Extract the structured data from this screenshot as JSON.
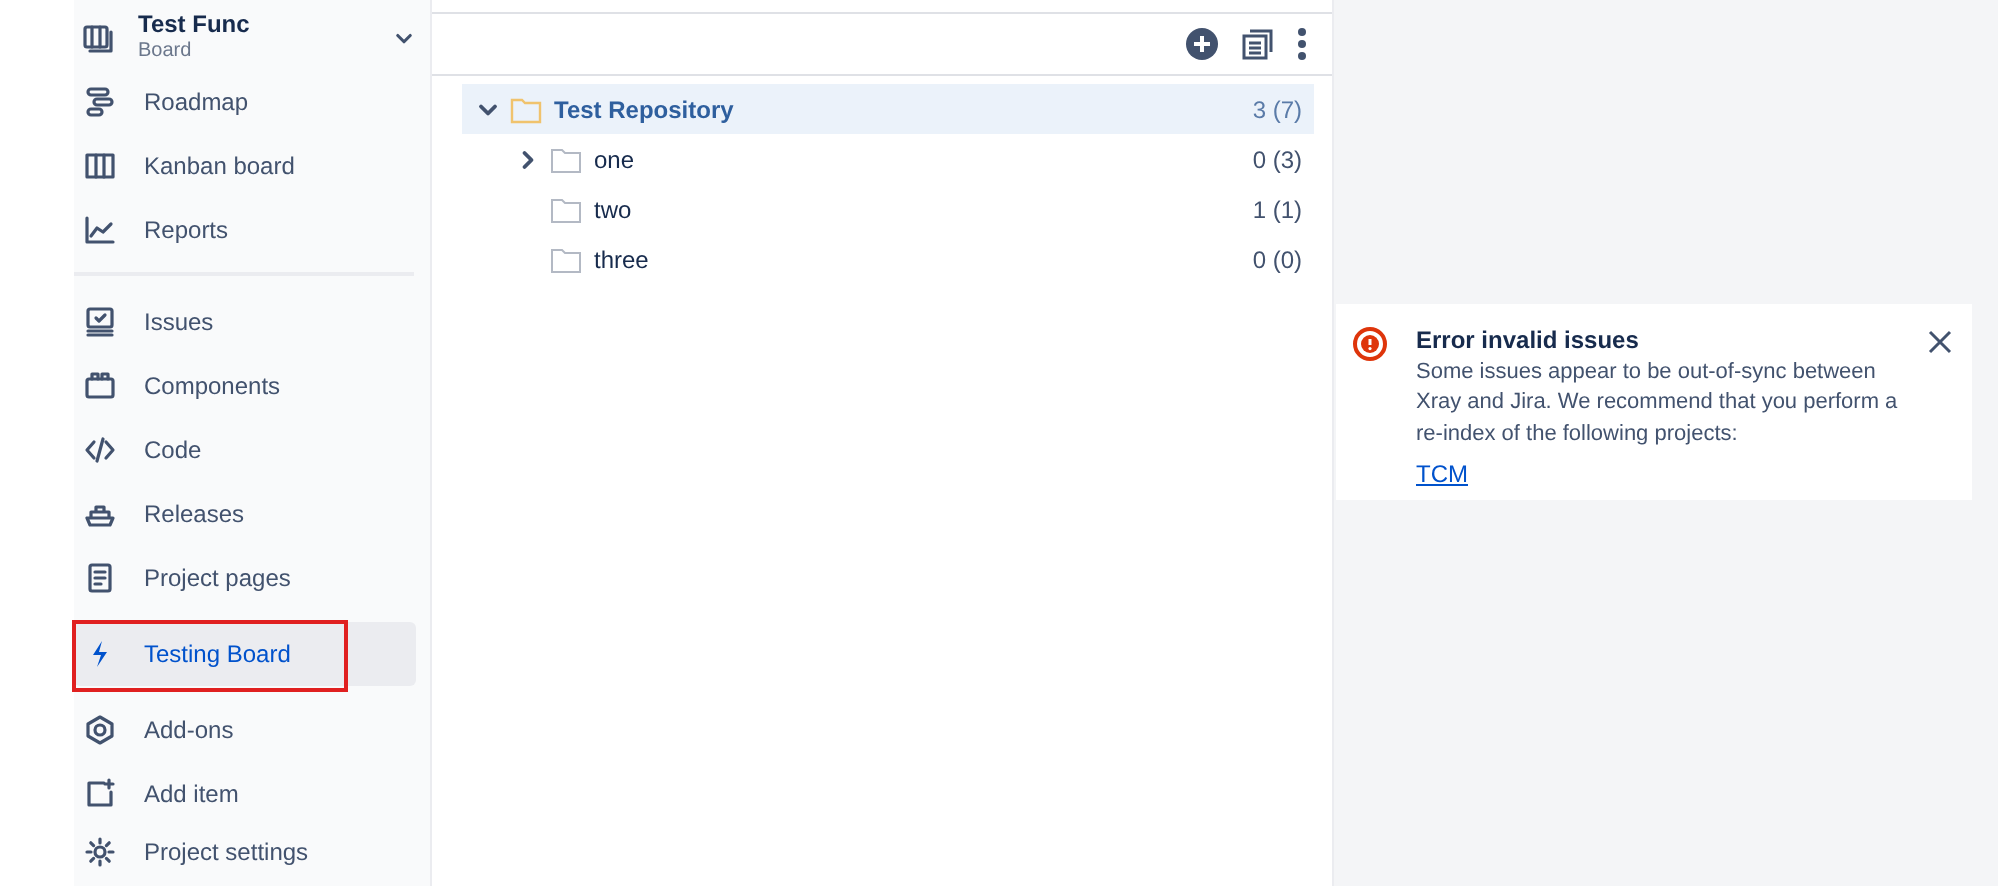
{
  "project": {
    "name": "Test Func",
    "type": "Board",
    "expanded": false
  },
  "sidebar": {
    "groups": [
      {
        "items": [
          {
            "label": "Roadmap",
            "selected": false
          },
          {
            "label": "Kanban board",
            "selected": false
          },
          {
            "label": "Reports",
            "selected": false
          }
        ]
      },
      {
        "items": [
          {
            "label": "Issues",
            "selected": false
          },
          {
            "label": "Components",
            "selected": false
          },
          {
            "label": "Code",
            "selected": false
          },
          {
            "label": "Releases",
            "selected": false
          },
          {
            "label": "Project pages",
            "selected": false
          },
          {
            "label": "Testing Board",
            "selected": true,
            "highlighted": true
          },
          {
            "label": "Add-ons",
            "selected": false
          },
          {
            "label": "Add item",
            "selected": false
          },
          {
            "label": "Project settings",
            "selected": false
          }
        ]
      }
    ]
  },
  "tree": [
    {
      "label": "Test Repository",
      "count": "3 (7)",
      "selected": true,
      "expanded": true,
      "children": [
        {
          "label": "one",
          "count": "0 (3)",
          "selected": false,
          "expanded": false
        },
        {
          "label": "two",
          "count": "1 (1)",
          "selected": false
        },
        {
          "label": "three",
          "count": "0 (0)",
          "selected": false
        }
      ]
    }
  ],
  "notification": {
    "title": "Error invalid issues",
    "message": "Some issues appear to be out-of-sync between Xray and Jira. We recommend that you perform a re-index of the following projects:",
    "link": "TCM"
  }
}
